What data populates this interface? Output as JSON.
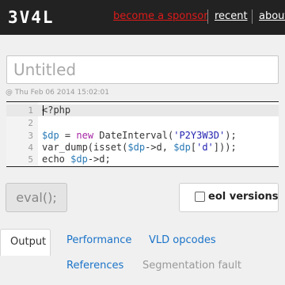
{
  "header": {
    "logo": "3V4L",
    "nav": {
      "sponsor": "become a sponsor",
      "recent": "recent",
      "about": "about"
    }
  },
  "editor_title": {
    "placeholder": "Untitled",
    "value": ""
  },
  "timestamp": "@ Thu Feb 06 2014 15:02:01",
  "code": {
    "line_numbers": [
      "1",
      "2",
      "3",
      "4",
      "5"
    ],
    "lines": {
      "l1": "<?php",
      "l3": {
        "v1": "$dp",
        "op": " = ",
        "kw": "new",
        "cls": " DateInterval(",
        "str": "'P2Y3W3D'",
        "end": ");"
      },
      "l4": {
        "a": "var_dump(isset(",
        "v1": "$dp",
        "b": "->d, ",
        "v2": "$dp",
        "c": "[",
        "str": "'d'",
        "d": "]));"
      },
      "l5": {
        "a": "echo ",
        "v1": "$dp",
        "b": "->d;"
      }
    }
  },
  "actions": {
    "eval_label": "eval();",
    "eol_label": "eol versions",
    "eol_checked": false
  },
  "tabs": {
    "output": "Output",
    "performance": "Performance",
    "vld": "VLD opcodes",
    "references": "References",
    "segfault": "Segmentation fault"
  },
  "colors": {
    "header_bg": "#222222",
    "sponsor_link": "#e01a1a",
    "tab_link": "#1a73c9"
  }
}
